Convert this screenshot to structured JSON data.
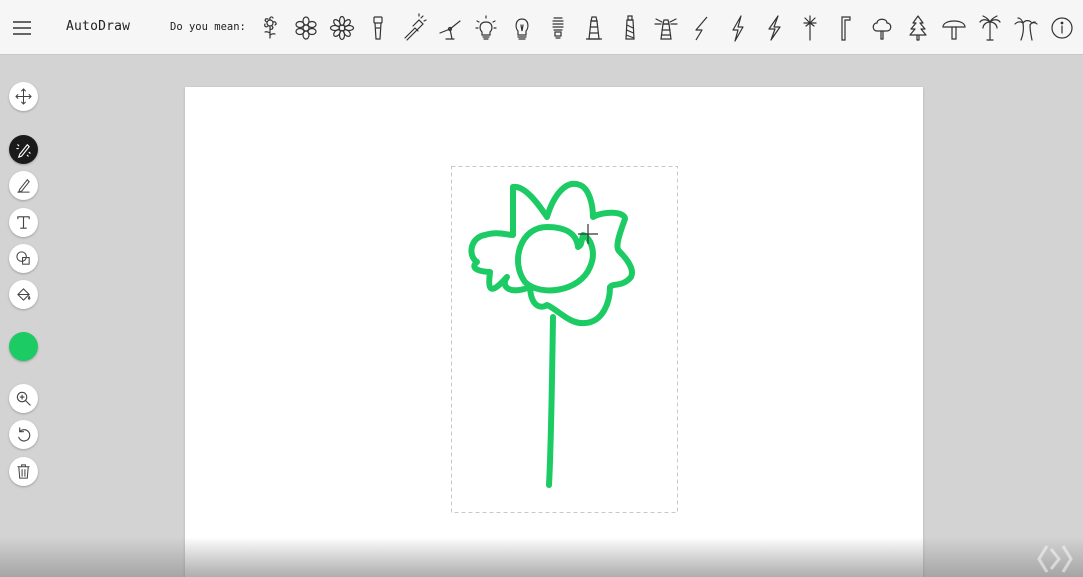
{
  "app": {
    "title": "AutoDraw"
  },
  "suggestions_bar": {
    "label": "Do you mean:",
    "items": [
      "flower-icon",
      "snowflake-icon",
      "daisy-icon",
      "flashlight-icon",
      "torch-icon",
      "wind-turbine-icon",
      "light-bulb-icon",
      "bulb-icon",
      "cfl-bulb-icon",
      "lighthouse-icon",
      "lighthouse-tower-icon",
      "lighthouse-beam-icon",
      "lightning-icon",
      "bolt-icon",
      "thunder-icon",
      "sparkler-icon",
      "pipe-icon",
      "tree-icon",
      "pine-tree-icon",
      "mushroom-icon",
      "palm-tree-icon",
      "palm-trees-icon",
      "info-icon"
    ]
  },
  "toolbar": {
    "tools": [
      "select-tool",
      "autodraw-tool",
      "draw-tool",
      "type-tool",
      "shape-tool",
      "fill-tool"
    ],
    "color": "#1ccb64",
    "actions": [
      "zoom-tool",
      "undo-tool",
      "delete-tool"
    ]
  },
  "drawing": {
    "stroke_color": "#1ccb64",
    "selection_color": "#c8c8c8"
  }
}
